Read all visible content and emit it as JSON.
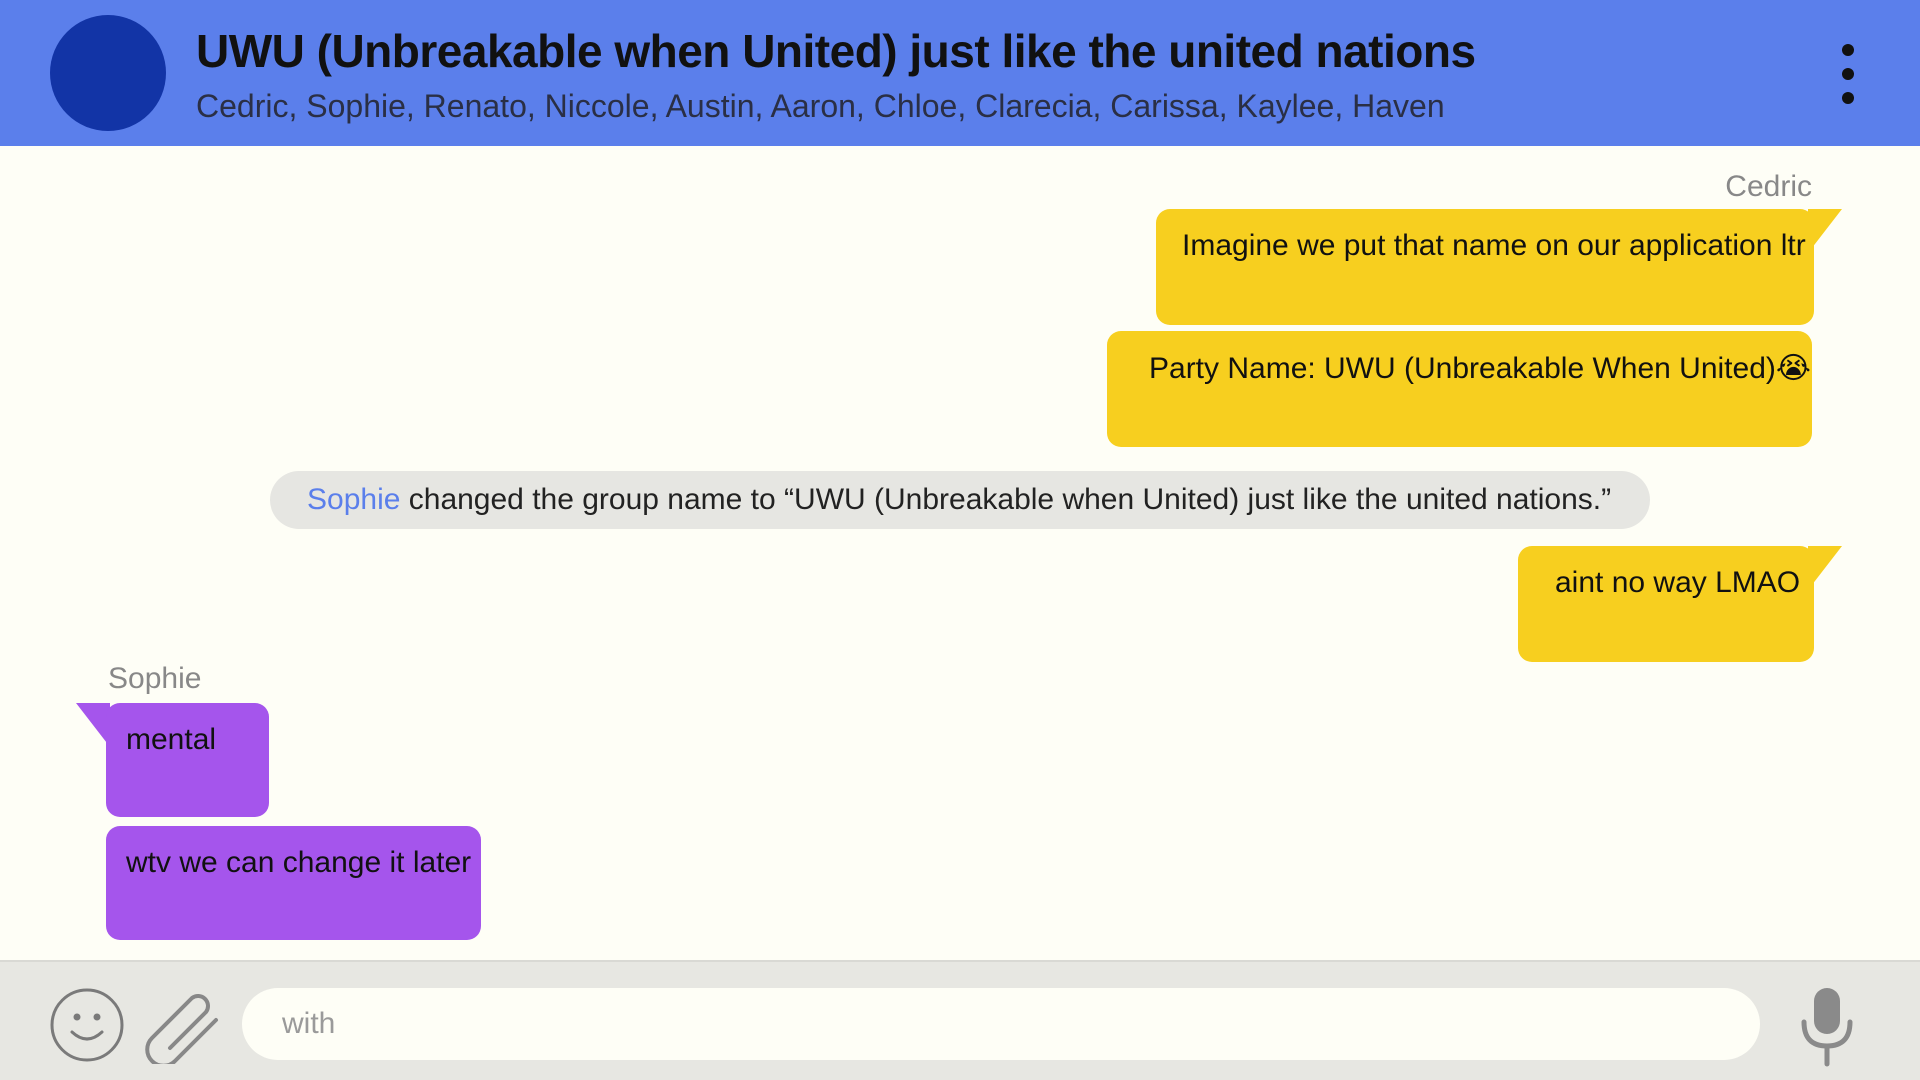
{
  "header": {
    "title": "UWU (Unbreakable when United) just like the united nations",
    "members": "Cedric, Sophie, Renato, Niccole, Austin, Aaron, Chloe, Clarecia, Carissa, Kaylee, Haven",
    "avatar_color": "#1234a6",
    "more_icon": "more-vertical-icon"
  },
  "messages": [
    {
      "sender": "Cedric",
      "text": "Imagine we put that name on our application ltr"
    },
    {
      "text": "Party Name: UWU (Unbreakable When United)😭"
    },
    {
      "text": "aint no way LMAO"
    },
    {
      "sender": "Sophie",
      "text": "mental"
    },
    {
      "text": "wtv we can change it later"
    }
  ],
  "system_event": {
    "name": "Sophie",
    "text": " changed the group name to “UWU (Unbreakable when United) just like the united nations.”"
  },
  "composer": {
    "placeholder": "with",
    "emoji_icon": "smiley-icon",
    "attach_icon": "paperclip-icon",
    "mic_icon": "microphone-icon"
  },
  "colors": {
    "header": "#5b7feb",
    "background": "#fefef6",
    "own_bubble": "#f7cf1f",
    "other_bubble": "#a555ec",
    "system_pill": "#e6e6e2",
    "composer": "#e7e7e2"
  }
}
